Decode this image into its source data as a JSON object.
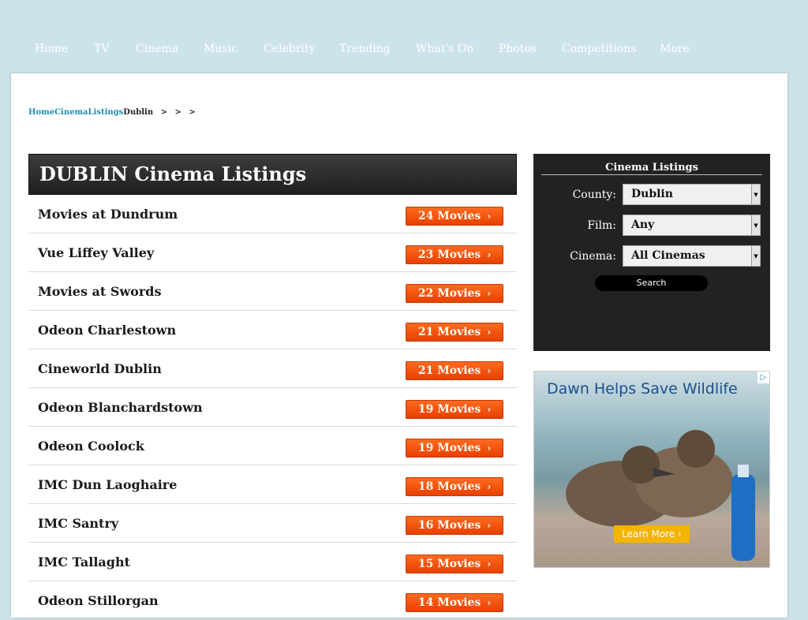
{
  "nav": {
    "items": [
      "Home",
      "TV",
      "Cinema",
      "Music",
      "Celebrity",
      "Trending",
      "What's On",
      "Photos",
      "Competitions",
      "More"
    ]
  },
  "breadcrumb": {
    "home": "Home",
    "cinema": "Cinema",
    "listings": "Listings",
    "current": "Dublin",
    "separators": ">",
    "link_color": "#1e8cb5"
  },
  "listing": {
    "title": "DUBLIN Cinema Listings",
    "button_color": "#ff5a10",
    "rows": [
      {
        "name": "Movies at Dundrum",
        "movies": "24 Movies"
      },
      {
        "name": "Vue Liffey Valley",
        "movies": "23 Movies"
      },
      {
        "name": "Movies at Swords",
        "movies": "22 Movies"
      },
      {
        "name": "Odeon Charlestown",
        "movies": "21 Movies"
      },
      {
        "name": "Cineworld Dublin",
        "movies": "21 Movies"
      },
      {
        "name": "Odeon Blanchardstown",
        "movies": "19 Movies"
      },
      {
        "name": "Odeon Coolock",
        "movies": "19 Movies"
      },
      {
        "name": "IMC Dun Laoghaire",
        "movies": "18 Movies"
      },
      {
        "name": "IMC Santry",
        "movies": "16 Movies"
      },
      {
        "name": "IMC Tallaght",
        "movies": "15 Movies"
      },
      {
        "name": "Odeon Stillorgan",
        "movies": "14 Movies"
      }
    ]
  },
  "sidebar": {
    "title": "Cinema Listings",
    "county_label": "County:",
    "county_value": "Dublin",
    "film_label": "Film:",
    "film_value": "Any",
    "cinema_label": "Cinema:",
    "cinema_value": "All Cinemas",
    "search_label": "Search"
  },
  "ad": {
    "headline": "Dawn Helps Save Wildlife",
    "cta": "Learn More",
    "adchoices_icon": "adchoices-icon"
  }
}
